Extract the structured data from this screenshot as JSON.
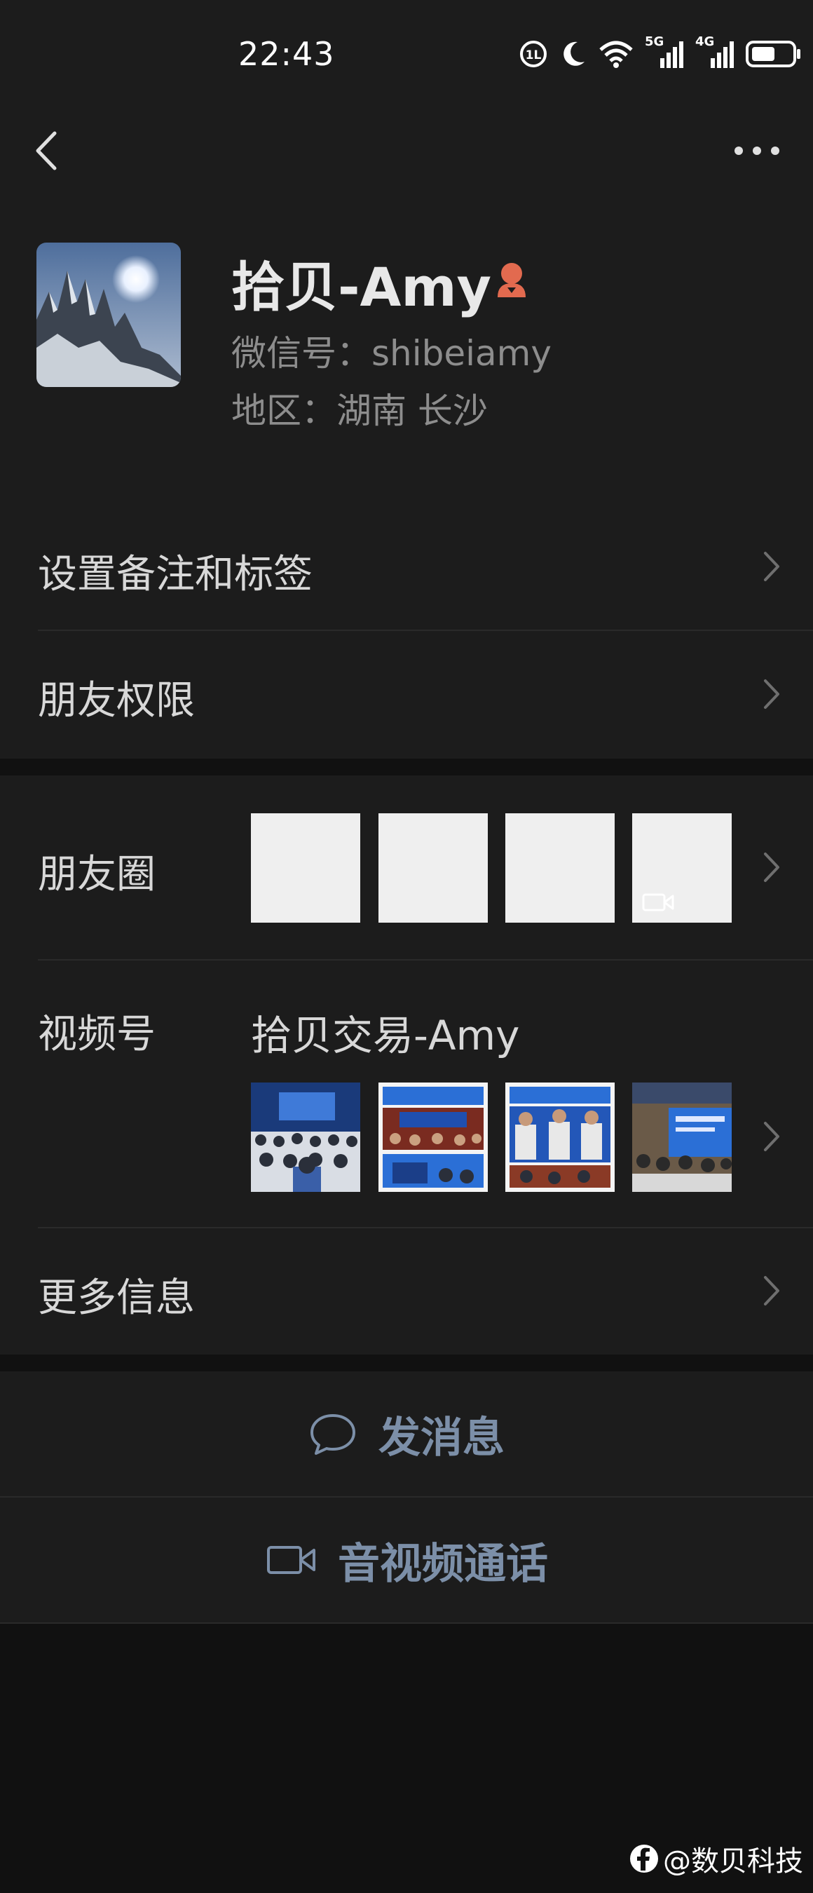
{
  "status_bar": {
    "time": "22:43",
    "network_1": "5G",
    "network_2": "4G"
  },
  "profile": {
    "name": "拾贝-Amy",
    "wechat_id": "微信号：shibeiamy",
    "region": "地区：湖南  长沙",
    "gender_icon": "female-icon"
  },
  "settings": {
    "remark_label": "设置备注和标签",
    "permissions_label": "朋友权限"
  },
  "moments": {
    "label": "朋友圈",
    "thumbnails": [
      "photo",
      "photo",
      "photo",
      "video"
    ]
  },
  "channels": {
    "label": "视频号",
    "channel_name": "拾贝交易-Amy",
    "thumbnails": [
      "conference-photo",
      "conference-photo",
      "conference-photo",
      "conference-photo"
    ]
  },
  "more_info": {
    "label": "更多信息"
  },
  "actions": {
    "message_label": "发消息",
    "call_label": "音视频通话"
  },
  "watermark": {
    "text": "@数贝科技"
  },
  "colors": {
    "background": "#1c1c1c",
    "separator": "#111111",
    "action_blue": "#7c8fa8",
    "gender_icon": "#e26a4f"
  }
}
